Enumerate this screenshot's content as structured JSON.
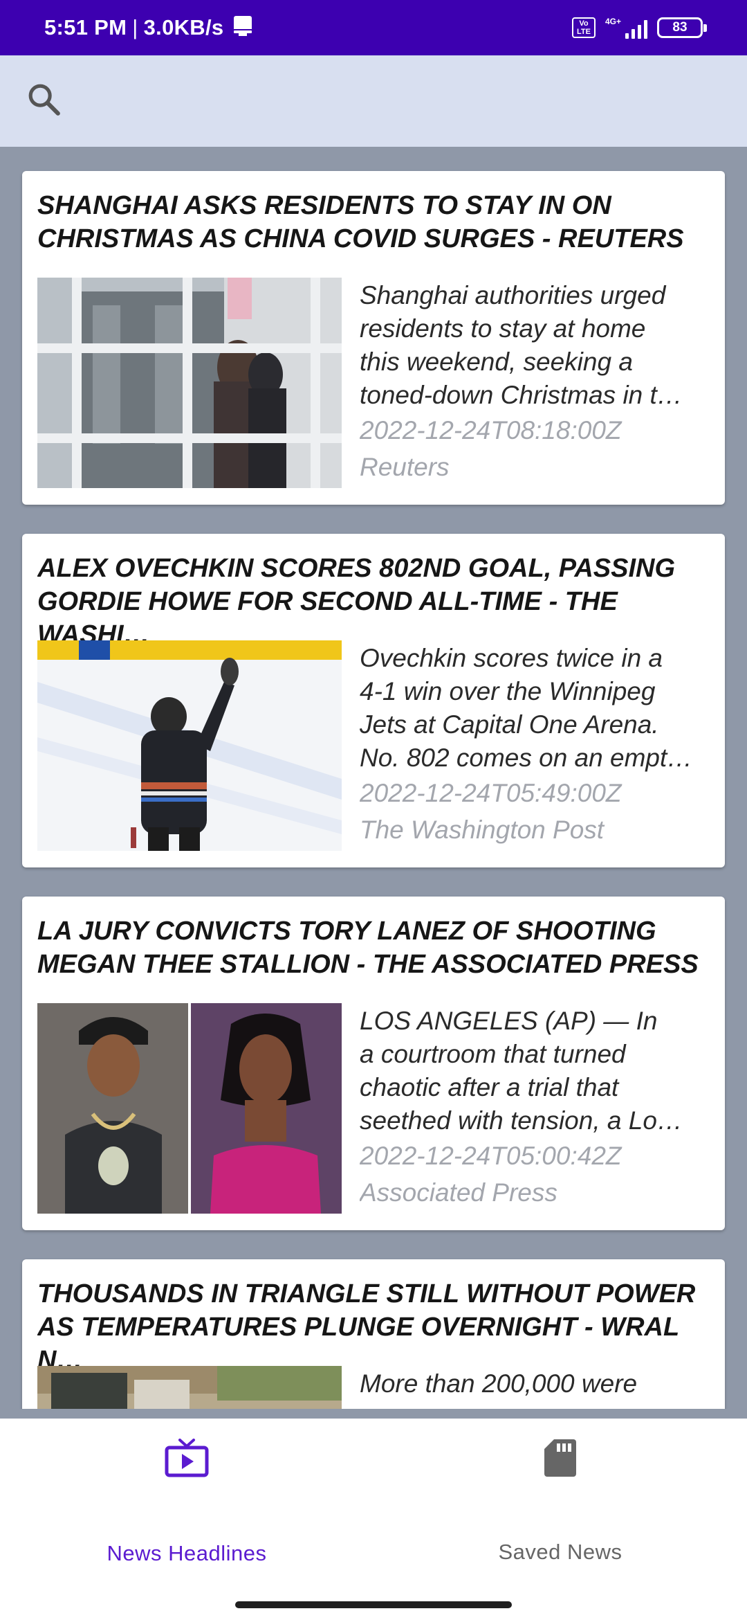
{
  "status_bar": {
    "time": "5:51 PM",
    "separator": "|",
    "speed": "3.0KB/s",
    "volte": "Vo LTE",
    "network": "4G+",
    "battery": "83"
  },
  "search": {
    "icon": "search-icon"
  },
  "articles": [
    {
      "title": "SHANGHAI ASKS RESIDENTS TO STAY IN ON\nCHRISTMAS AS CHINA COVID SURGES - REUTERS",
      "description": "Shanghai authorities urged\nresidents to stay at home\nthis weekend, seeking a\ntoned-down Christmas in t…",
      "date": "2022-12-24T08:18:00Z",
      "source": "Reuters"
    },
    {
      "title": "ALEX OVECHKIN SCORES 802ND GOAL, PASSING\nGORDIE HOWE FOR SECOND ALL-TIME - THE WASHI…",
      "description": "Ovechkin scores twice in a\n4-1 win over the Winnipeg\nJets at Capital One Arena.\nNo. 802 comes on an empt…",
      "date": "2022-12-24T05:49:00Z",
      "source": "The Washington Post"
    },
    {
      "title": "LA JURY CONVICTS TORY LANEZ OF SHOOTING\nMEGAN THEE STALLION - THE ASSOCIATED PRESS",
      "description": "LOS ANGELES (AP) — In\na courtroom that turned\nchaotic after a trial that\nseethed with tension, a Lo…",
      "date": "2022-12-24T05:00:42Z",
      "source": "Associated Press"
    },
    {
      "title": "THOUSANDS IN TRIANGLE STILL WITHOUT POWER\nAS TEMPERATURES PLUNGE OVERNIGHT - WRAL N…",
      "description": "More than 200,000 were",
      "date": "",
      "source": ""
    }
  ],
  "bottom_nav": {
    "items": [
      {
        "label": "News Headlines",
        "icon": "tv-play-icon",
        "active": true
      },
      {
        "label": "Saved News",
        "icon": "sd-card-icon",
        "active": false
      }
    ],
    "active_color": "#5b1bd0",
    "inactive_color": "#666666"
  }
}
